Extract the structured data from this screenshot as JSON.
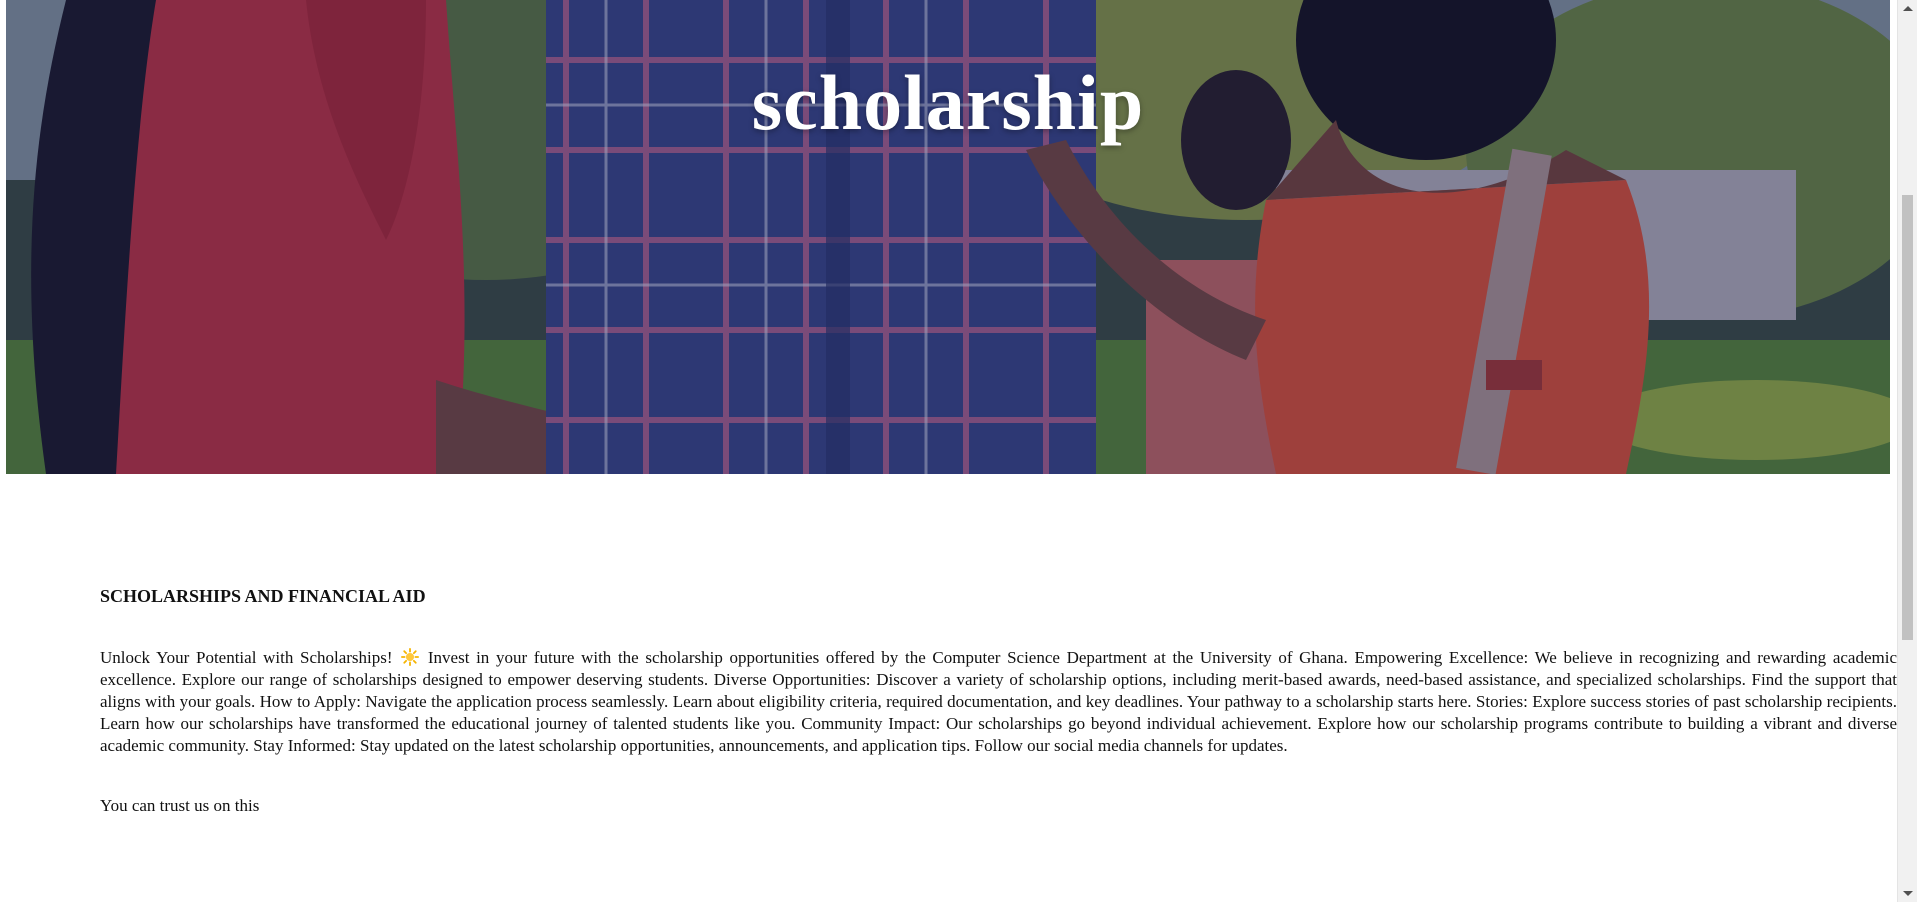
{
  "hero": {
    "title": "scholarship"
  },
  "section": {
    "heading": "SCHOLARSHIPS AND FINANCIAL AID",
    "intro_before_emoji": "Unlock Your Potential with Scholarships! ",
    "emoji_icon": "sun-icon",
    "intro_after_emoji": " Invest in your future with the scholarship opportunities offered by the Computer Science Department at the University of Ghana. Empowering Excellence: We believe in recognizing and rewarding academic excellence. Explore our range of scholarships designed to empower deserving students. Diverse Opportunities: Discover a variety of scholarship options, including merit-based awards, need-based assistance, and specialized scholarships. Find the support that aligns with your goals. How to Apply: Navigate the application process seamlessly. Learn about eligibility criteria, required documentation, and key deadlines. Your pathway to a scholarship starts here. Stories: Explore success stories of past scholarship recipients. Learn how our scholarships have transformed the educational journey of talented students like you. Community Impact: Our scholarships go beyond individual achievement. Explore how our scholarship programs contribute to building a vibrant and diverse academic community. Stay Informed: Stay updated on the latest scholarship opportunities, announcements, and application tips. Follow our social media channels for updates.",
    "trust_line": "You can trust us on this"
  },
  "colors": {
    "overlay": "#14195a",
    "title_text": "#ffffff",
    "body_text": "#111111",
    "scroll_thumb": "#c1c1c1"
  }
}
